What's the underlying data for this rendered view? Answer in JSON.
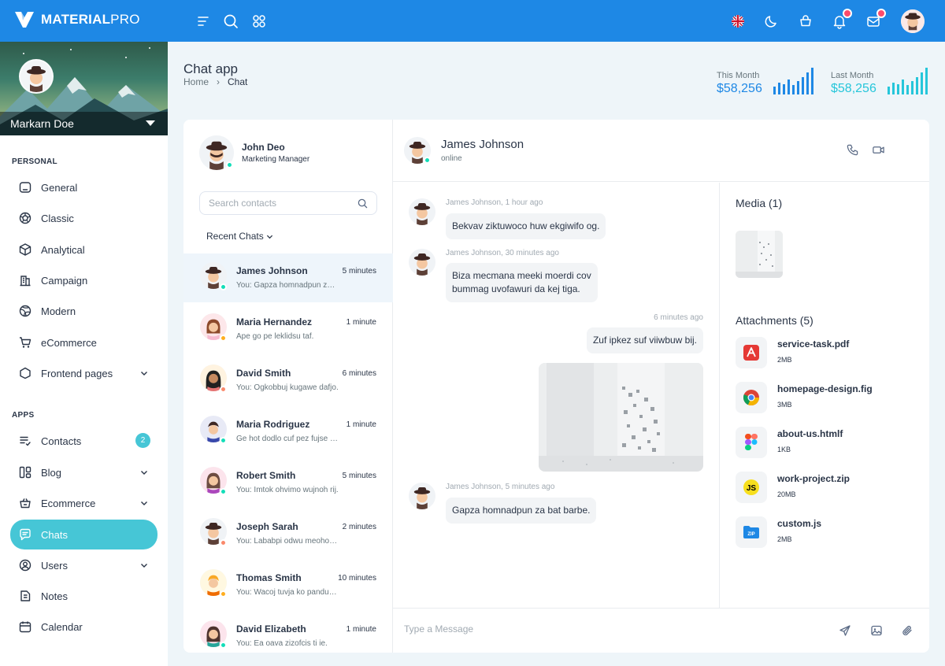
{
  "app": {
    "logo_bold": "MATERIAL",
    "logo_light": "PRO"
  },
  "topbar": {
    "icons": [
      "menu-icon",
      "search-icon",
      "apps-icon",
      "uk-flag-icon",
      "moon-icon",
      "cart-icon",
      "bell-icon",
      "mail-icon"
    ]
  },
  "sidebar": {
    "profile_name": "Markarn Doe",
    "personal_caption": "PERSONAL",
    "apps_caption": "APPS",
    "personal": [
      {
        "label": "General",
        "icon": "home-icon"
      },
      {
        "label": "Classic",
        "icon": "aperture-icon"
      },
      {
        "label": "Analytical",
        "icon": "box-icon"
      },
      {
        "label": "Campaign",
        "icon": "building-icon"
      },
      {
        "label": "Modern",
        "icon": "globe-icon"
      },
      {
        "label": "eCommerce",
        "icon": "cart-icon"
      },
      {
        "label": "Frontend pages",
        "icon": "app-window-icon",
        "has_chevron": true
      }
    ],
    "apps": [
      {
        "label": "Contacts",
        "icon": "contacts-icon",
        "badge": "2"
      },
      {
        "label": "Blog",
        "icon": "blog-icon",
        "has_chevron": true
      },
      {
        "label": "Ecommerce",
        "icon": "basket-icon",
        "has_chevron": true
      },
      {
        "label": "Chats",
        "icon": "message-icon",
        "active": true
      },
      {
        "label": "Users",
        "icon": "user-circle-icon",
        "has_chevron": true
      },
      {
        "label": "Notes",
        "icon": "notes-icon"
      },
      {
        "label": "Calendar",
        "icon": "calendar-icon"
      }
    ]
  },
  "header": {
    "title": "Chat app",
    "breadcrumb": {
      "home": "Home",
      "current": "Chat"
    },
    "stats": [
      {
        "label": "This Month",
        "value": "$58,256",
        "color": "#1e88e5"
      },
      {
        "label": "Last Month",
        "value": "$58,256",
        "color": "#26c6da"
      }
    ]
  },
  "contacts": {
    "me": {
      "name": "John Deo",
      "role": "Marketing Manager"
    },
    "search_placeholder": "Search contacts",
    "recent_label": "Recent Chats",
    "list": [
      {
        "name": "James Johnson",
        "time": "5 minutes",
        "msg": "You: Gapza homnadpun za bat barbe.",
        "status": "#13deb9",
        "active": true
      },
      {
        "name": "Maria Hernandez",
        "time": "1 minute",
        "msg": "Ape go pe leklidsu taf.",
        "status": "#ffae1f"
      },
      {
        "name": "David Smith",
        "time": "6 minutes",
        "msg": "You: Ogkobbuj kugawe dafjo.",
        "status": "#fa896b"
      },
      {
        "name": "Maria Rodriguez",
        "time": "1 minute",
        "msg": "Ge hot dodlo cuf pez fujse ha.",
        "status": "#13deb9"
      },
      {
        "name": "Robert Smith",
        "time": "5 minutes",
        "msg": "You: Imtok ohvimo wujnoh rij.",
        "status": "#13deb9"
      },
      {
        "name": "Joseph Sarah",
        "time": "2 minutes",
        "msg": "You: Lababpi odwu meoho nun.",
        "status": "#fa896b"
      },
      {
        "name": "Thomas Smith",
        "time": "10 minutes",
        "msg": "You: Wacoj tuvja ko pandu hu.",
        "status": "#ffae1f"
      },
      {
        "name": "David Elizabeth",
        "time": "1 minute",
        "msg": "You: Ea oava zizofcis ti ie.",
        "status": "#13deb9"
      }
    ]
  },
  "chat": {
    "name": "James Johnson",
    "status": "online",
    "messages": [
      {
        "meta": "James Johnson, 1 hour ago",
        "text": "Bekvav ziktuwoco huw ekgiwifo og."
      },
      {
        "meta": "James Johnson, 30 minutes ago",
        "text_line1": "Biza mecmana meeki moerdi cov",
        "text_line2": "bummag uvofawuri da kej tiga."
      },
      {
        "meta": "6 minutes ago",
        "text": "Zuf ipkez suf viiwbuw bij."
      },
      {
        "meta": "James Johnson, 5 minutes ago",
        "text": "Gapza homnadpun za bat barbe."
      }
    ],
    "composer_placeholder": "Type a Message"
  },
  "media": {
    "title": "Media (1)",
    "attachments_title": "Attachments (5)",
    "files": [
      {
        "name": "service-task.pdf",
        "size": "2MB",
        "icon": "pdf-icon",
        "color": "#e53935"
      },
      {
        "name": "homepage-design.fig",
        "size": "3MB",
        "icon": "chrome-icon",
        "color": "#4285f4"
      },
      {
        "name": "about-us.htmlf",
        "size": "1KB",
        "icon": "figma-icon",
        "color": "#a259ff"
      },
      {
        "name": "work-project.zip",
        "size": "20MB",
        "icon": "js-icon",
        "color": "#f7df1e"
      },
      {
        "name": "custom.js",
        "size": "2MB",
        "icon": "zip-icon",
        "color": "#1e88e5"
      }
    ]
  }
}
